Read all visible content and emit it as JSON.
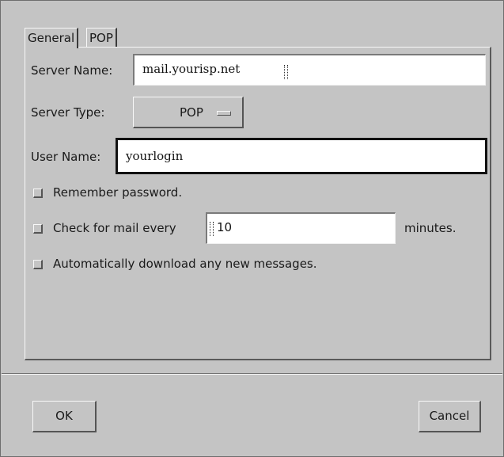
{
  "tabs": [
    "General",
    "POP"
  ],
  "general": {
    "server_name_label": "Server Name:",
    "server_name_value": "mail.yourisp.net",
    "server_type_label": "Server Type:",
    "server_type_value": "POP",
    "user_name_label": "User Name:",
    "user_name_value": "yourlogin",
    "remember_password_label": "Remember password.",
    "check_mail_label": "Check for mail every",
    "check_mail_minutes_value": "10",
    "minutes_label": "minutes.",
    "auto_download_label": "Automatically download any new messages."
  },
  "buttons": {
    "ok": "OK",
    "cancel": "Cancel"
  }
}
